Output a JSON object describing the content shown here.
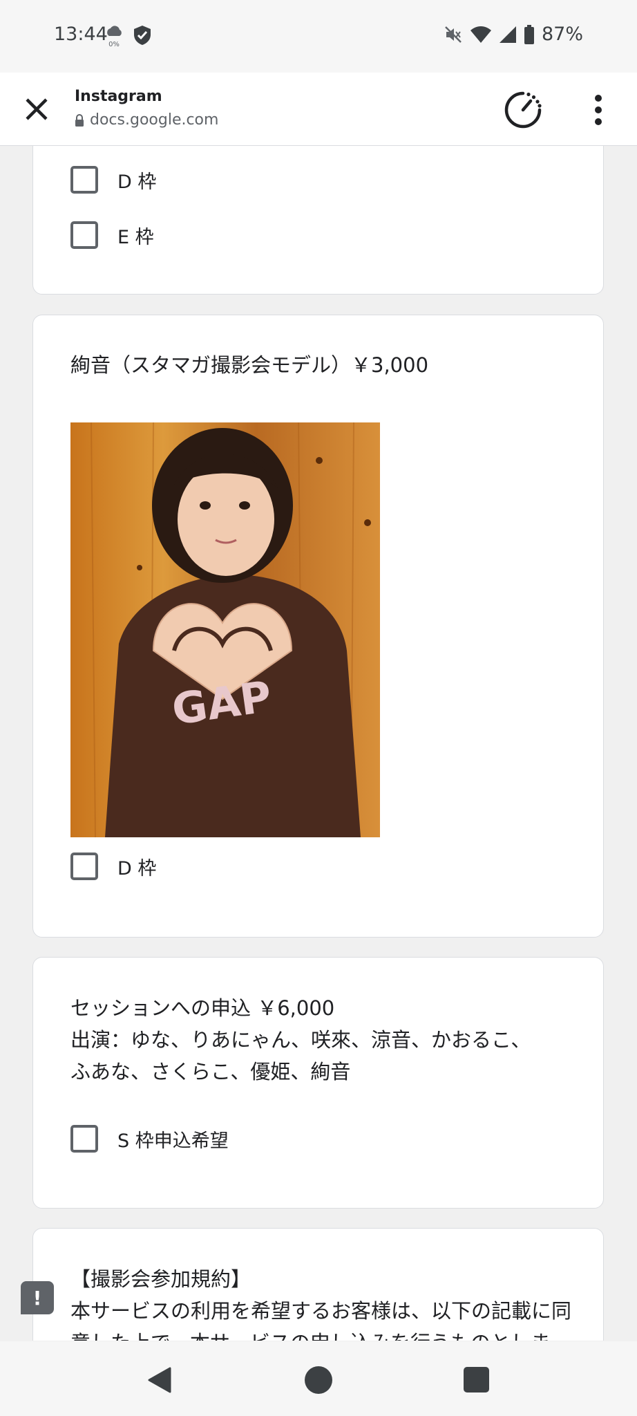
{
  "status_bar": {
    "time": "13:44",
    "data_saver_label": "0%",
    "battery": "87%",
    "icons": [
      "cloud-icon",
      "shield-icon",
      "mute-icon",
      "wifi-icon",
      "signal-icon",
      "battery-icon"
    ]
  },
  "browser": {
    "title": "Instagram",
    "url": "docs.google.com"
  },
  "form": {
    "card1": {
      "options": [
        {
          "label": "D 枠"
        },
        {
          "label": "E 枠"
        }
      ]
    },
    "card2": {
      "title": "絢音（スタマガ撮影会モデル）￥3,000",
      "options": [
        {
          "label": "D 枠"
        }
      ]
    },
    "card3": {
      "title_line1": "セッションへの申込 ￥6,000",
      "title_line2": "出演：ゆな、りあにゃん、咲來、涼音、かおるこ、",
      "title_line3": "ふあな、さくらこ、優姫、絢音",
      "options": [
        {
          "label": "S 枠申込希望"
        }
      ]
    },
    "card4": {
      "title_line1": "【撮影会参加規約】",
      "title_line2": "本サービスの利用を希望するお客様は、以下の記載に同",
      "title_line3": "意した上で、本サービスの申し込みを行うものとしま"
    }
  },
  "feedback": {
    "label": "!"
  },
  "colors": {
    "page_background": "#f0f0f0",
    "card_background": "#ffffff",
    "checkbox_border": "#5f6368"
  }
}
